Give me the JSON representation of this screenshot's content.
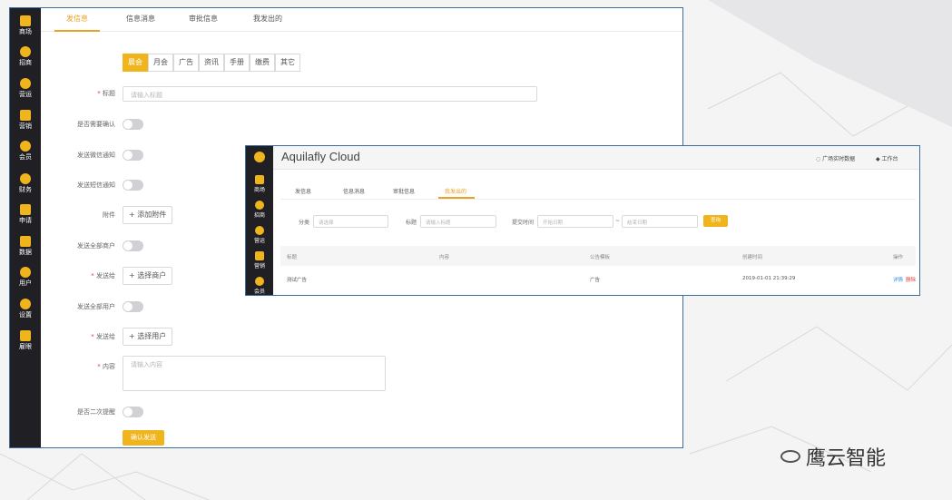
{
  "win1": {
    "sidebar": [
      "商场",
      "招商",
      "营运",
      "营销",
      "会员",
      "财务",
      "申请",
      "数据",
      "用户",
      "设置",
      "雇眼"
    ],
    "tabs": [
      "发信息",
      "信息消息",
      "审批信息",
      "我发出的"
    ],
    "categories": [
      "晨会",
      "月会",
      "广告",
      "资讯",
      "手册",
      "缴费",
      "其它"
    ],
    "form": {
      "title_label": "标题",
      "title_placeholder": "请输入标题",
      "confirm_label": "是否需要确认",
      "wechat_label": "发送微信通知",
      "sms_label": "发送短信通知",
      "attach_label": "附件",
      "attach_btn": "+ 添加附件",
      "all_merchants_label": "发送全部商户",
      "send_to_label": "发送给",
      "select_merchant_btn": "+ 选择商户",
      "all_users_label": "发送全部用户",
      "select_user_btn": "+ 选择用户",
      "content_label": "内容",
      "content_placeholder": "请输入内容",
      "remind_label": "是否二次提醒",
      "submit": "确认发送"
    }
  },
  "win2": {
    "brand": "Aquilafly Cloud",
    "links": [
      "广场实时数据",
      "工作台"
    ],
    "sidebar": [
      "商场",
      "招商",
      "营运",
      "营销",
      "会员"
    ],
    "tabs": [
      "发信息",
      "信息消息",
      "审批信息",
      "我发出的"
    ],
    "filters": {
      "category_label": "分类",
      "category_placeholder": "请选择",
      "title_label": "标题",
      "title_placeholder": "请输入标题",
      "time_label": "提交时间",
      "start_placeholder": "开始日期",
      "end_placeholder": "结束日期",
      "query": "查询"
    },
    "columns": [
      "标题",
      "内容",
      "公告模板",
      "创建时间",
      "操作"
    ],
    "rows": [
      {
        "title": "测试广告",
        "content": "",
        "template": "广告",
        "time": "2019-01-01 21:39:29",
        "detail": "详情",
        "delete": "删除"
      }
    ]
  },
  "watermark": "鹰云智能",
  "colors": {
    "accent": "#f0b51c",
    "sidebar": "#1f1f24",
    "border": "#3d6d9d"
  }
}
